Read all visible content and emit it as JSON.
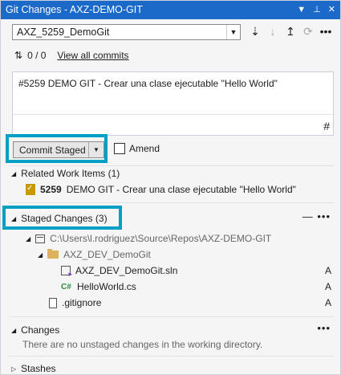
{
  "window": {
    "title": "Git Changes - AXZ-DEMO-GIT",
    "icons": [
      "dropdown-icon",
      "pin-icon",
      "close-icon"
    ]
  },
  "branch": {
    "name": "AXZ_5259_DemoGit",
    "actions": [
      "fetch-icon",
      "pull-icon",
      "push-icon",
      "sync-icon",
      "more-icon"
    ]
  },
  "sync": {
    "counts": "0 / 0",
    "view_all_commits": "View all commits"
  },
  "commit_message": "#5259 DEMO GIT - Crear una clase ejecutable \"Hello World\"",
  "commit": {
    "button_label": "Commit Staged",
    "amend_label": "Amend"
  },
  "related_work_items": {
    "header": "Related Work Items (1)",
    "items": [
      {
        "id": "5259",
        "title": "DEMO GIT - Crear una clase ejecutable \"Hello World\""
      }
    ]
  },
  "staged_changes": {
    "header": "Staged Changes (3)",
    "repo_path": "C:\\Users\\l.rodriguez\\Source\\Repos\\AXZ-DEMO-GIT",
    "folder": "AXZ_DEV_DemoGit",
    "files": [
      {
        "name": "AXZ_DEV_DemoGit.sln",
        "status": "A"
      },
      {
        "name": "HelloWorld.cs",
        "status": "A"
      },
      {
        "name": ".gitignore",
        "status": "A"
      }
    ]
  },
  "changes": {
    "header": "Changes",
    "empty_text": "There are no unstaged changes in the working directory."
  },
  "stashes": {
    "header": "Stashes"
  },
  "colors": {
    "titlebar": "#1b6ac9",
    "highlight": "#00a0c6"
  }
}
